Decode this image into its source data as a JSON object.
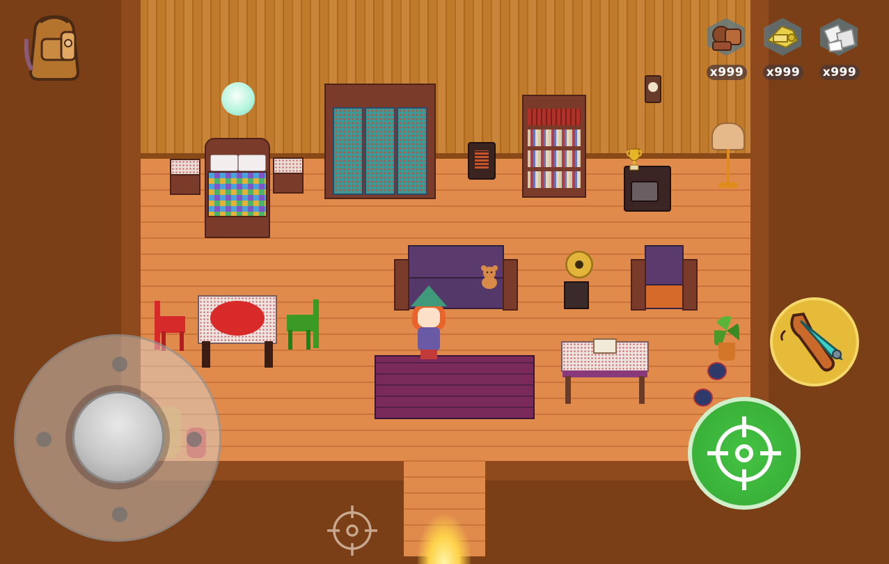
{
  "hud": {
    "backpack": {
      "icon": "backpack-icon",
      "color": "#b4742e"
    },
    "resources": [
      {
        "icon": "scrap-parts-icon",
        "count": "x999"
      },
      {
        "icon": "gold-scrap-icon",
        "count": "x999"
      },
      {
        "icon": "paper-scrap-icon",
        "count": "x999"
      }
    ],
    "joystick": {
      "icon": "joystick-icon"
    },
    "aim_cursor": {
      "icon": "crosshair-icon"
    },
    "fire_button": {
      "icon": "crosshair-icon",
      "color": "#3ab23a"
    },
    "weapon_button": {
      "icon": "slingshot-icon",
      "color": "#e7bb3a"
    }
  },
  "scene": {
    "palette": {
      "floor": "#e08b4c",
      "wall": "#c07a2c",
      "rug": "#7a2a5a",
      "sofa": "#5b3b6e",
      "table_cloth": "#d92a2a",
      "chair_red": "#d62a2a",
      "chair_green": "#3a9a24"
    }
  }
}
